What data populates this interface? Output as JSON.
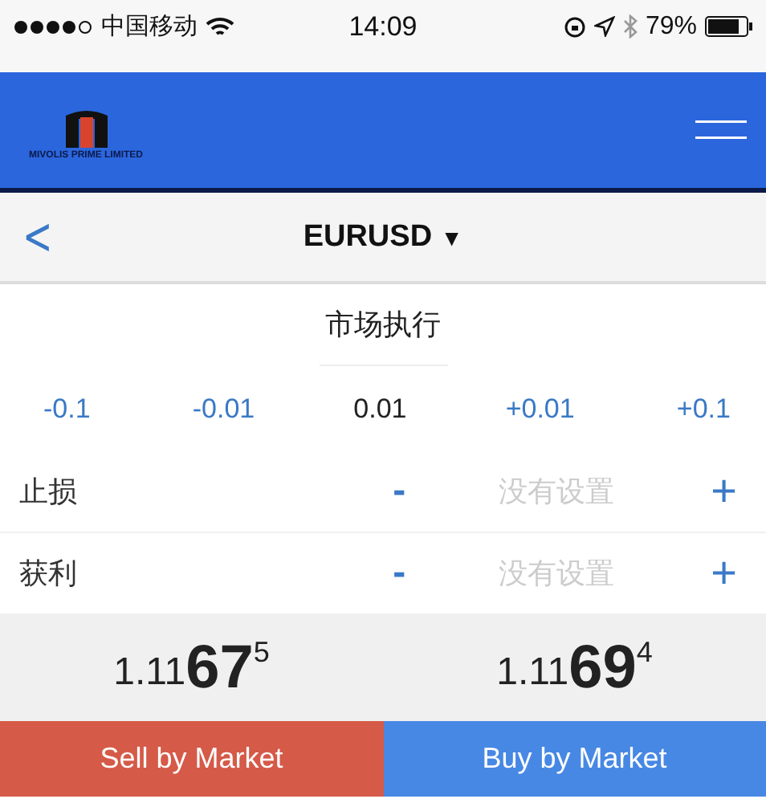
{
  "status_bar": {
    "carrier": "中国移动",
    "time": "14:09",
    "battery": "79%"
  },
  "header": {
    "brand": "MIVOLIS PRIME LIMITED"
  },
  "nav": {
    "back": "<",
    "symbol": "EURUSD",
    "caret": "▼"
  },
  "order_type": "市场执行",
  "volume": [
    {
      "kind": "step",
      "label": "-0.1"
    },
    {
      "kind": "step",
      "label": "-0.01"
    },
    {
      "kind": "value",
      "label": "0.01"
    },
    {
      "kind": "step",
      "label": "+0.01"
    },
    {
      "kind": "step",
      "label": "+0.1"
    }
  ],
  "levels": [
    {
      "label": "止损",
      "minus": "-",
      "placeholder": "没有设置",
      "plus": "+"
    },
    {
      "label": "获利",
      "minus": "-",
      "placeholder": "没有设置",
      "plus": "+"
    }
  ],
  "prices": [
    {
      "prefix": "1.11",
      "big": "67",
      "sup": "5"
    },
    {
      "prefix": "1.11",
      "big": "69",
      "sup": "4"
    }
  ],
  "actions": [
    {
      "kind": "sell",
      "label": "Sell by Market"
    },
    {
      "kind": "buy",
      "label": "Buy by Market"
    }
  ]
}
